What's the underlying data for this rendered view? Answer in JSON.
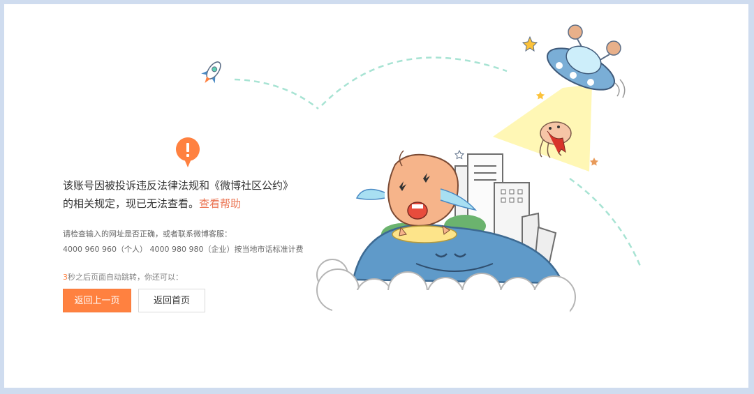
{
  "colors": {
    "accent": "#ff8140",
    "link": "#eb7350",
    "page_background": "#cfdcef"
  },
  "message": {
    "line1": "该账号因被投诉违反法律法规和《微博社区公约》",
    "line2": "的相关规定，现已无法查看。",
    "help_link": "查看帮助"
  },
  "contact": {
    "line1": "请检查输入的网址是否正确，或者联系微博客服：",
    "line2": "4000 960 960（个人） 4000 980 980（企业）按当地市话标准计费"
  },
  "redirect": {
    "seconds": "3",
    "text": "秒之后页面自动跳转，你还可以："
  },
  "buttons": {
    "back_label": "返回上一页",
    "home_label": "返回首页"
  },
  "icons": {
    "warning": "warning-icon",
    "rocket": "rocket-icon",
    "ufo": "ufo-icon"
  }
}
